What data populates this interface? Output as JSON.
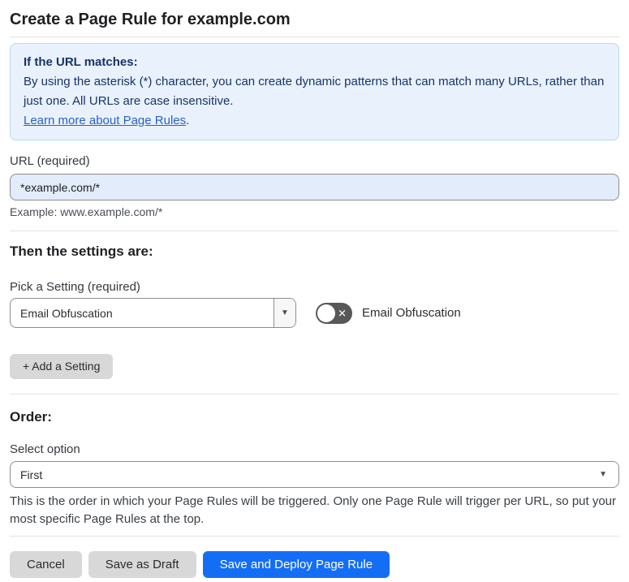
{
  "page": {
    "title": "Create a Page Rule for example.com"
  },
  "info_box": {
    "heading": "If the URL matches:",
    "body": "By using the asterisk (*) character, you can create dynamic patterns that can match many URLs, rather than just one. All URLs are case insensitive.",
    "link_label": "Learn more about Page Rules",
    "link_suffix": "."
  },
  "url_field": {
    "label": "URL (required)",
    "value": "*example.com/*",
    "helper": "Example: www.example.com/*"
  },
  "settings_section": {
    "heading": "Then the settings are:",
    "pick_setting_label": "Pick a Setting (required)",
    "selected_setting": "Email Obfuscation",
    "toggle_label": "Email Obfuscation",
    "toggle_state": "off",
    "add_setting_button": "+ Add a Setting"
  },
  "order_section": {
    "heading": "Order:",
    "select_label": "Select option",
    "selected_option": "First",
    "helper": "This is the order in which your Page Rules will be triggered. Only one Page Rule will trigger per URL, so put your most specific Page Rules at the top."
  },
  "footer": {
    "cancel_label": "Cancel",
    "save_draft_label": "Save as Draft",
    "save_deploy_label": "Save and Deploy Page Rule"
  },
  "icons": {
    "dropdown_arrow": "▼",
    "toggle_off_x": "✕"
  },
  "colors": {
    "accent_blue": "#146ef5",
    "info_bg": "#e9f2fc",
    "info_border": "#b9d6f2",
    "info_text": "#17336b",
    "link_blue": "#2b5fc7",
    "input_bg": "#e2ecfa",
    "toggle_off_bg": "#585858",
    "gray_button_bg": "#d8d8d8"
  }
}
